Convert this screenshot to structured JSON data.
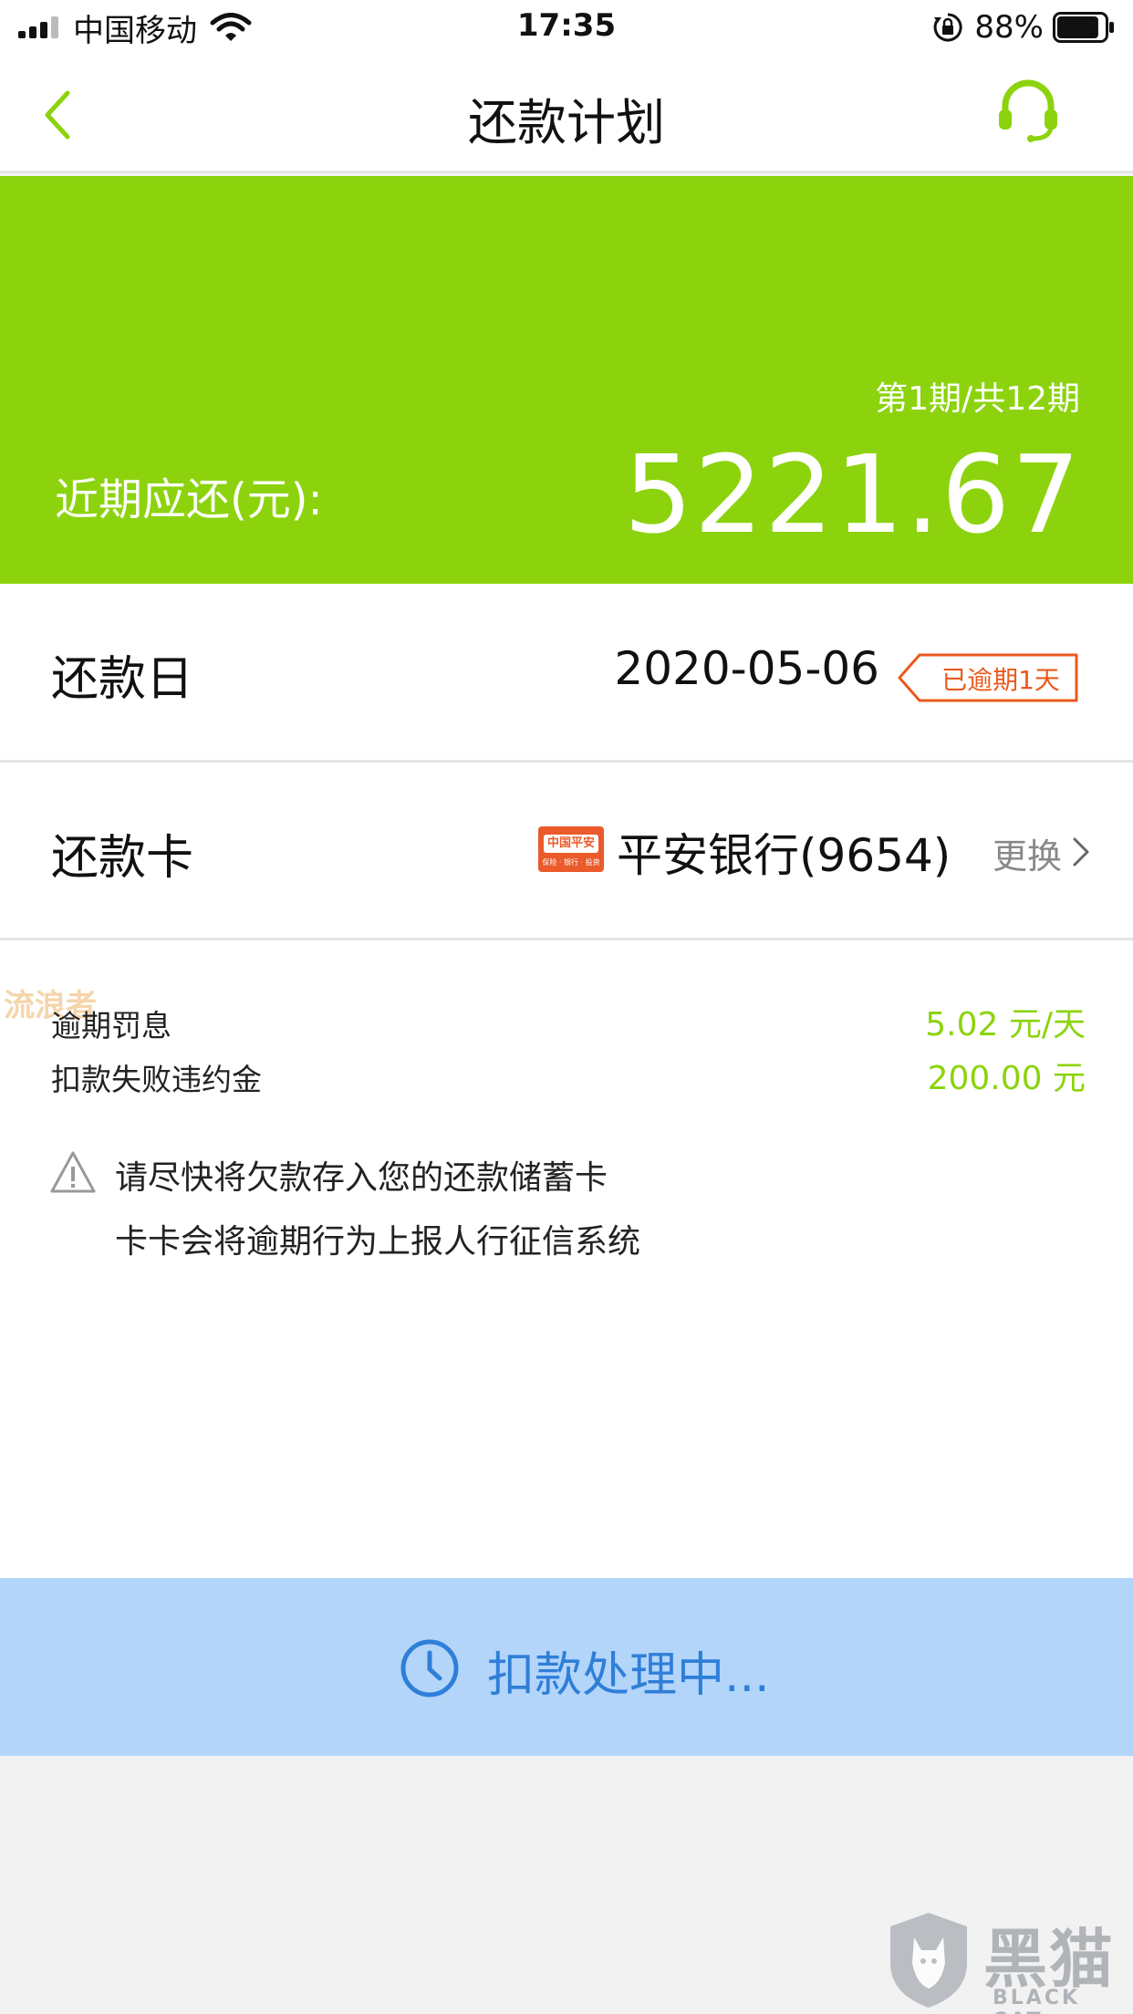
{
  "status_bar": {
    "carrier": "中国移动",
    "time": "17:35",
    "battery_percent": "88%",
    "battery_level": 0.88
  },
  "nav": {
    "title": "还款计划",
    "back_icon": "chevron-left-icon",
    "service_icon": "headset-icon"
  },
  "summary": {
    "period": "第1期/共12期",
    "label": "近期应还(元):",
    "amount": "5221.67"
  },
  "repay_date": {
    "label": "还款日",
    "value": "2020-05-06",
    "overdue_badge": "已逾期1天"
  },
  "repay_card": {
    "label": "还款卡",
    "bank_logo": "中国平安",
    "bank_logo_sub": "保险 · 银行 · 投资",
    "bank": "平安银行(9654)",
    "change": "更换"
  },
  "fees": [
    {
      "label": "逾期罚息",
      "value": "5.02 元/天"
    },
    {
      "label": "扣款失败违约金",
      "value": "200.00 元"
    }
  ],
  "notice": {
    "line1": "请尽快将欠款存入您的还款储蓄卡",
    "line2": "卡卡会将逾期行为上报人行征信系统"
  },
  "action": {
    "label": "扣款处理中..."
  },
  "watermarks": {
    "overlay": "流浪者",
    "brand_cn": "黑猫",
    "brand_en": "BLACK CAT"
  },
  "colors": {
    "accent_green": "#8cd30e",
    "overdue_orange": "#ea5a1c",
    "action_bg": "#b3d5fa",
    "action_text": "#2f7fd8"
  }
}
